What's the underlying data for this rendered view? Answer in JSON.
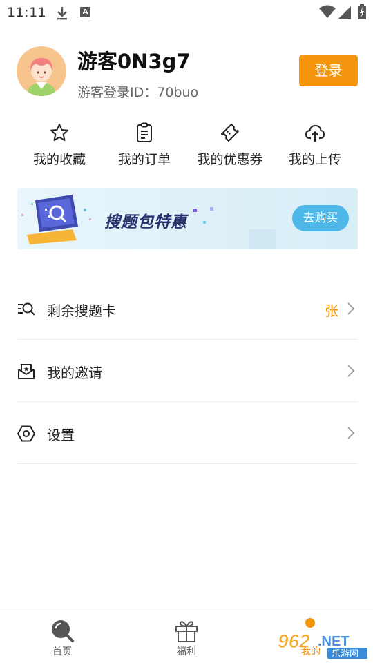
{
  "status_bar": {
    "time": "11:11",
    "a_badge": "A"
  },
  "profile": {
    "username": "游客0N3g7",
    "user_id": "游客登录ID：70buo",
    "login_label": "登录"
  },
  "quick_actions": [
    {
      "label": "我的收藏",
      "icon": "star-icon"
    },
    {
      "label": "我的订单",
      "icon": "clipboard-icon"
    },
    {
      "label": "我的优惠券",
      "icon": "ticket-icon"
    },
    {
      "label": "我的上传",
      "icon": "cloud-upload-icon"
    }
  ],
  "banner": {
    "title": "搜题包特惠",
    "button_label": "去购买"
  },
  "menu": [
    {
      "label": "剩余搜题卡",
      "value": "张",
      "icon": "search-list-icon"
    },
    {
      "label": "我的邀请",
      "value": "",
      "icon": "mail-icon"
    },
    {
      "label": "设置",
      "value": "",
      "icon": "settings-hexagon-icon"
    }
  ],
  "bottom_nav": [
    {
      "label": "首页",
      "icon": "search-icon"
    },
    {
      "label": "福利",
      "icon": "gift-icon"
    },
    {
      "label": "我的",
      "icon": "profile-icon"
    }
  ],
  "watermark": {
    "logo": "962",
    "suffix": ".NET",
    "caption": "乐游网"
  },
  "colors": {
    "accent": "#f5940d",
    "banner_button": "#4db7e8",
    "banner_title": "#2a3270"
  }
}
